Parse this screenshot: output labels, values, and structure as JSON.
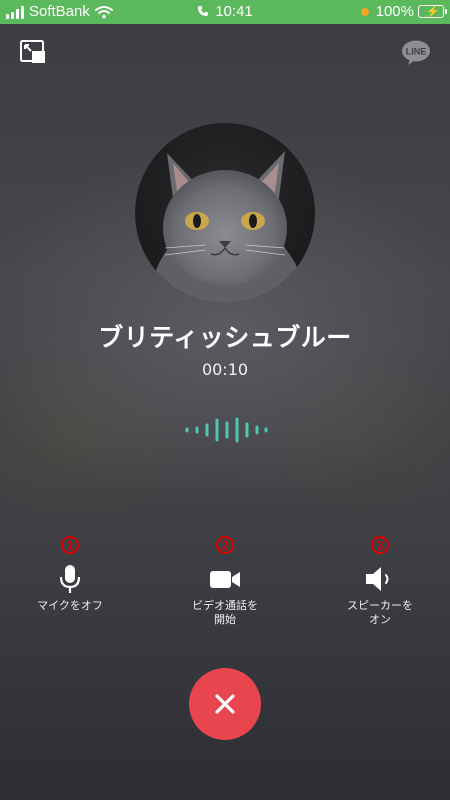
{
  "status_bar": {
    "carrier": "SoftBank",
    "time": "10:41",
    "battery": "100%"
  },
  "caller": {
    "name": "ブリティッシュブルー",
    "duration": "00:10"
  },
  "controls": [
    {
      "number": "①",
      "label": "マイクをオフ",
      "icon": "microphone-icon"
    },
    {
      "number": "②",
      "label": "ビデオ通話を\n開始",
      "icon": "video-camera-icon"
    },
    {
      "number": "③",
      "label": "スピーカーを\nオン",
      "icon": "speaker-icon"
    }
  ],
  "icons": {
    "top_left": "picture-in-picture-icon",
    "top_right": "line-logo",
    "end_call": "close-icon"
  },
  "logo_text": "LINE",
  "colors": {
    "status_bar": "#5cb85c",
    "end_call": "#e8454f",
    "annotation_red": "#e00000",
    "wave_teal": "#4fc7b0"
  }
}
